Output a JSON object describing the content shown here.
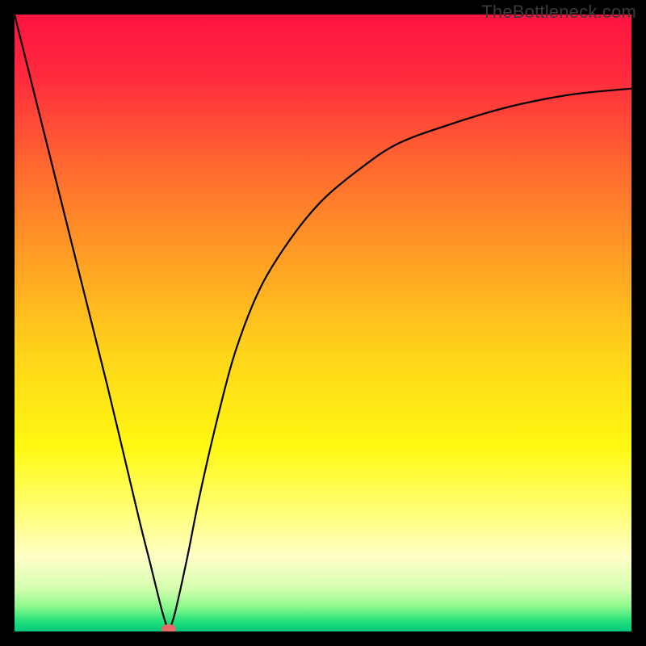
{
  "watermark": "TheBottleneck.com",
  "chart_data": {
    "type": "line",
    "title": "",
    "xlabel": "",
    "ylabel": "",
    "x_range": [
      0,
      100
    ],
    "y_range": [
      0,
      100
    ],
    "grid": false,
    "legend": null,
    "dip_position_x": 25,
    "marker": {
      "x": 25,
      "y": 0,
      "color": "#e96a6a"
    },
    "background_gradient": {
      "stops": [
        {
          "offset": 0.0,
          "color": "#ff1440"
        },
        {
          "offset": 0.1,
          "color": "#ff2a3e"
        },
        {
          "offset": 0.25,
          "color": "#ff6a2f"
        },
        {
          "offset": 0.4,
          "color": "#ffa024"
        },
        {
          "offset": 0.55,
          "color": "#ffd41a"
        },
        {
          "offset": 0.7,
          "color": "#fff812"
        },
        {
          "offset": 0.8,
          "color": "#ffff70"
        },
        {
          "offset": 0.88,
          "color": "#ffffc8"
        },
        {
          "offset": 0.93,
          "color": "#d5ffb0"
        },
        {
          "offset": 0.96,
          "color": "#8cf88c"
        },
        {
          "offset": 0.985,
          "color": "#1ee07a"
        },
        {
          "offset": 1.0,
          "color": "#00c47a"
        }
      ]
    },
    "series": [
      {
        "name": "bottleneck_curve",
        "x": [
          0,
          5,
          10,
          15,
          20,
          22,
          24,
          25,
          26,
          28,
          30,
          33,
          36,
          40,
          45,
          50,
          56,
          62,
          70,
          80,
          90,
          100
        ],
        "y": [
          100,
          80,
          60,
          40,
          19,
          11,
          3,
          0,
          3,
          12,
          22,
          35,
          46,
          56,
          64,
          70,
          75,
          79,
          82,
          85,
          87,
          88
        ]
      }
    ]
  }
}
